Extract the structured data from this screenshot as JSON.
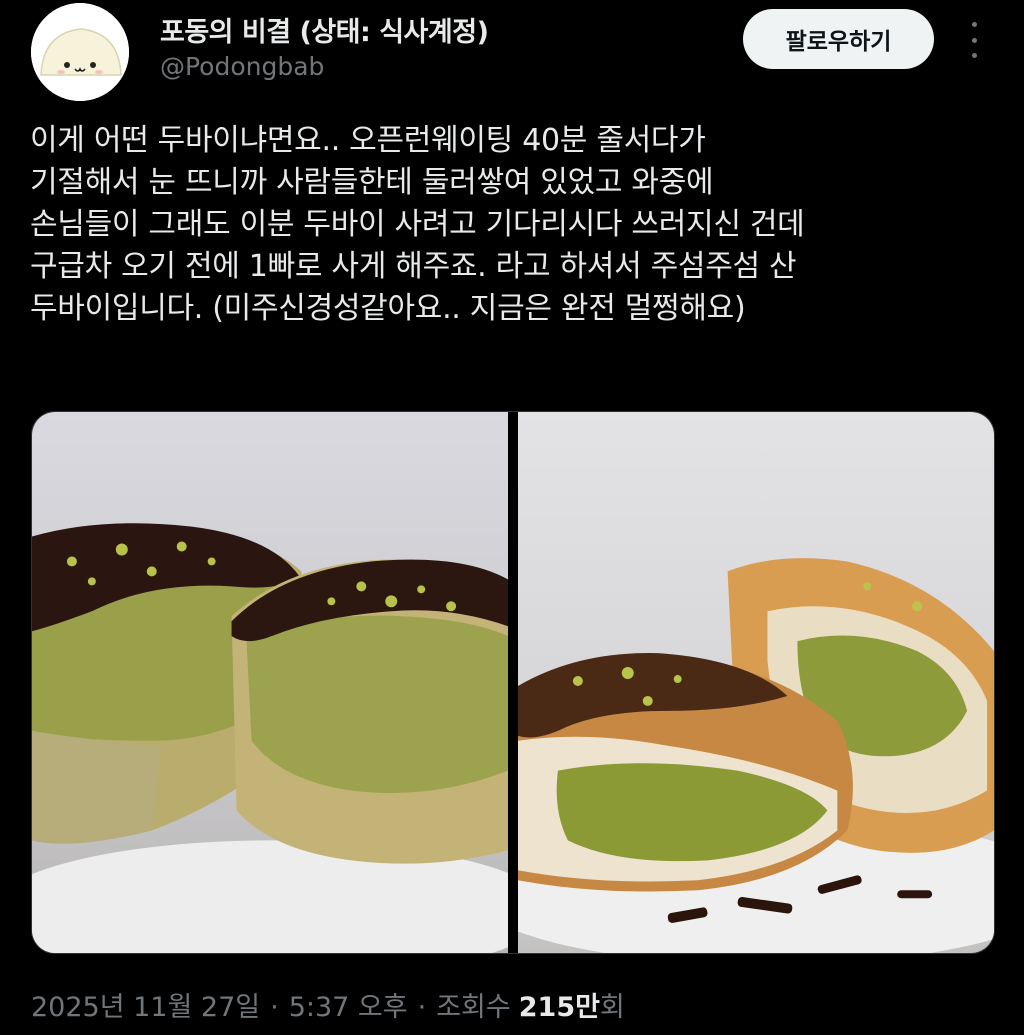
{
  "author": {
    "display_name": "포동의 비결 (상태: 식사계정)",
    "handle": "@Podongbab",
    "avatar_icon": "rice-cake-face-icon"
  },
  "actions": {
    "follow_label": "팔로우하기",
    "more_icon": "more-vertical-icon"
  },
  "tweet": {
    "lines": [
      "이게 어떤 두바이냐면요.. 오픈런웨이팅 40분 줄서다가",
      "기절해서 눈 뜨니까 사람들한테 둘러쌓여 있었고 와중에",
      "손님들이 그래도 이분 두바이 사려고 기다리시다 쓰러지신 건데",
      "구급차 오기 전에 1빠로 사게 해주죠. 라고 하셔서 주섬주섬 산",
      "두바이입니다. (미주신경성같아요.. 지금은 완전 멀쩡해요)"
    ]
  },
  "media": {
    "photos": [
      {
        "subject": "chocolate-topped pastry cut in half with pistachio filling"
      },
      {
        "subject": "croissant pastry torn open with green pistachio cream"
      }
    ]
  },
  "meta": {
    "date": "2025년 11월 27일",
    "separator": "·",
    "time": "5:37 오후",
    "views_label": "조회수",
    "views_value": "215만",
    "views_suffix": "회"
  },
  "colors": {
    "background": "#000000",
    "text_primary": "#e7e9ea",
    "text_secondary": "#71767b",
    "follow_button_bg": "#eff3f4"
  }
}
